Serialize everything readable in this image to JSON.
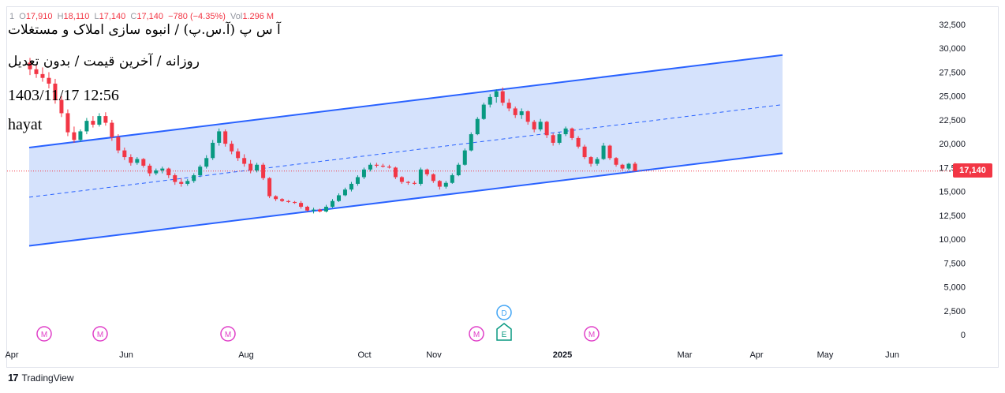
{
  "legend": {
    "interval": "1",
    "open_label": "O",
    "open": "17,910",
    "high_label": "H",
    "high": "18,110",
    "low_label": "L",
    "low": "17,140",
    "close_label": "C",
    "close": "17,140",
    "change": "−780 (−4.35%)",
    "vol_label": "Vol",
    "vol": "1.296 M"
  },
  "overlay": {
    "symbol": "آ س پ (آ.س.پ) / انبوه سازی املاک و مستغلات",
    "settings": "روزانه / آخرین قیمت / بدون تعدیل",
    "timestamp": "1403/11/17 12:56",
    "author": "hayat"
  },
  "price_badge": "17,140",
  "footer": {
    "brand": "TradingView",
    "logo": "17"
  },
  "colors": {
    "up": "#089981",
    "down": "#f23645",
    "channel_line": "#2962ff",
    "channel_fill": "#d3e0fc",
    "marker": "#e040c8",
    "dividend": "#42a5f5",
    "earnings": "#089981"
  },
  "chart_data": {
    "type": "candlestick",
    "y_ticks": [
      "32,500",
      "30,000",
      "27,500",
      "25,000",
      "22,500",
      "20,000",
      "17,500",
      "15,000",
      "12,500",
      "10,000",
      "7,500",
      "5,000",
      "2,500",
      "0"
    ],
    "x_ticks": [
      "Apr",
      "Jun",
      "Aug",
      "Oct",
      "Nov",
      "2025",
      "Mar",
      "Apr",
      "May",
      "Jun"
    ],
    "ylim": [
      0,
      32500
    ],
    "last_price": 17140,
    "channel": {
      "upper": [
        [
          0.0,
          19600
        ],
        [
          1.0,
          29300
        ]
      ],
      "mid": [
        [
          0.0,
          14400
        ],
        [
          1.0,
          24100
        ]
      ],
      "lower": [
        [
          0.0,
          9300
        ],
        [
          1.0,
          19000
        ]
      ]
    },
    "series": [
      {
        "o": 28500,
        "h": 29000,
        "l": 27200,
        "c": 27800
      },
      {
        "o": 27800,
        "h": 28300,
        "l": 26900,
        "c": 27300
      },
      {
        "o": 27300,
        "h": 28000,
        "l": 26500,
        "c": 26900
      },
      {
        "o": 26900,
        "h": 27500,
        "l": 25800,
        "c": 26300
      },
      {
        "o": 26300,
        "h": 26800,
        "l": 24200,
        "c": 24600
      },
      {
        "o": 24600,
        "h": 25000,
        "l": 22800,
        "c": 23200
      },
      {
        "o": 23200,
        "h": 23600,
        "l": 20800,
        "c": 21200
      },
      {
        "o": 21200,
        "h": 21800,
        "l": 20100,
        "c": 20400
      },
      {
        "o": 20400,
        "h": 21500,
        "l": 20200,
        "c": 21300
      },
      {
        "o": 21300,
        "h": 22700,
        "l": 21000,
        "c": 22400
      },
      {
        "o": 22400,
        "h": 22900,
        "l": 21700,
        "c": 22000
      },
      {
        "o": 22000,
        "h": 23200,
        "l": 21800,
        "c": 22900
      },
      {
        "o": 22900,
        "h": 23300,
        "l": 21900,
        "c": 22200
      },
      {
        "o": 22200,
        "h": 22500,
        "l": 20300,
        "c": 20700
      },
      {
        "o": 20700,
        "h": 21000,
        "l": 19000,
        "c": 19300
      },
      {
        "o": 19300,
        "h": 19600,
        "l": 18300,
        "c": 18600
      },
      {
        "o": 18600,
        "h": 18900,
        "l": 17700,
        "c": 18000
      },
      {
        "o": 18000,
        "h": 18600,
        "l": 17800,
        "c": 18400
      },
      {
        "o": 18400,
        "h": 18500,
        "l": 17500,
        "c": 17700
      },
      {
        "o": 17700,
        "h": 17900,
        "l": 16600,
        "c": 16900
      },
      {
        "o": 16900,
        "h": 17400,
        "l": 16700,
        "c": 17200
      },
      {
        "o": 17200,
        "h": 17600,
        "l": 16900,
        "c": 17400
      },
      {
        "o": 17400,
        "h": 17500,
        "l": 16400,
        "c": 16700
      },
      {
        "o": 16700,
        "h": 16900,
        "l": 15700,
        "c": 16000
      },
      {
        "o": 16000,
        "h": 16400,
        "l": 15500,
        "c": 15800
      },
      {
        "o": 15800,
        "h": 16300,
        "l": 15600,
        "c": 16100
      },
      {
        "o": 16100,
        "h": 16900,
        "l": 15900,
        "c": 16700
      },
      {
        "o": 16700,
        "h": 17800,
        "l": 16500,
        "c": 17600
      },
      {
        "o": 17600,
        "h": 18800,
        "l": 17400,
        "c": 18500
      },
      {
        "o": 18500,
        "h": 20400,
        "l": 18300,
        "c": 20100
      },
      {
        "o": 20100,
        "h": 21600,
        "l": 19800,
        "c": 21300
      },
      {
        "o": 21300,
        "h": 21500,
        "l": 19700,
        "c": 20000
      },
      {
        "o": 20000,
        "h": 20300,
        "l": 18900,
        "c": 19200
      },
      {
        "o": 19200,
        "h": 19500,
        "l": 18200,
        "c": 18500
      },
      {
        "o": 18500,
        "h": 18900,
        "l": 17600,
        "c": 17900
      },
      {
        "o": 17900,
        "h": 18300,
        "l": 16900,
        "c": 17200
      },
      {
        "o": 17200,
        "h": 18000,
        "l": 17000,
        "c": 17800
      },
      {
        "o": 17800,
        "h": 18000,
        "l": 16200,
        "c": 16400
      },
      {
        "o": 16400,
        "h": 16500,
        "l": 14300,
        "c": 14500
      },
      {
        "o": 14500,
        "h": 14600,
        "l": 14000,
        "c": 14200
      },
      {
        "o": 14200,
        "h": 14300,
        "l": 13900,
        "c": 14000
      },
      {
        "o": 14000,
        "h": 14100,
        "l": 13800,
        "c": 13900
      },
      {
        "o": 13900,
        "h": 14000,
        "l": 13700,
        "c": 13800
      },
      {
        "o": 13800,
        "h": 14000,
        "l": 13200,
        "c": 13400
      },
      {
        "o": 13400,
        "h": 13500,
        "l": 12900,
        "c": 13000
      },
      {
        "o": 13000,
        "h": 13300,
        "l": 12700,
        "c": 13100
      },
      {
        "o": 13100,
        "h": 13200,
        "l": 12800,
        "c": 12900
      },
      {
        "o": 12900,
        "h": 13600,
        "l": 12800,
        "c": 13400
      },
      {
        "o": 13400,
        "h": 14200,
        "l": 13300,
        "c": 14000
      },
      {
        "o": 14000,
        "h": 14800,
        "l": 13900,
        "c": 14600
      },
      {
        "o": 14600,
        "h": 15400,
        "l": 14500,
        "c": 15200
      },
      {
        "o": 15200,
        "h": 16000,
        "l": 15000,
        "c": 15800
      },
      {
        "o": 15800,
        "h": 16700,
        "l": 15600,
        "c": 16500
      },
      {
        "o": 16500,
        "h": 17500,
        "l": 16300,
        "c": 17300
      },
      {
        "o": 17300,
        "h": 18000,
        "l": 17100,
        "c": 17800
      },
      {
        "o": 17800,
        "h": 18000,
        "l": 17500,
        "c": 17700
      },
      {
        "o": 17700,
        "h": 17900,
        "l": 17500,
        "c": 17600
      },
      {
        "o": 17600,
        "h": 17800,
        "l": 17400,
        "c": 17500
      },
      {
        "o": 17500,
        "h": 17600,
        "l": 16300,
        "c": 16500
      },
      {
        "o": 16500,
        "h": 16600,
        "l": 15800,
        "c": 16000
      },
      {
        "o": 16000,
        "h": 16100,
        "l": 15700,
        "c": 15900
      },
      {
        "o": 15900,
        "h": 16100,
        "l": 15700,
        "c": 15800
      },
      {
        "o": 15800,
        "h": 17500,
        "l": 15600,
        "c": 17300
      },
      {
        "o": 17300,
        "h": 17400,
        "l": 16600,
        "c": 16800
      },
      {
        "o": 16800,
        "h": 16900,
        "l": 15900,
        "c": 16100
      },
      {
        "o": 16100,
        "h": 16200,
        "l": 15200,
        "c": 15500
      },
      {
        "o": 15500,
        "h": 16100,
        "l": 15300,
        "c": 15900
      },
      {
        "o": 15900,
        "h": 16900,
        "l": 15800,
        "c": 16700
      },
      {
        "o": 16700,
        "h": 18000,
        "l": 16600,
        "c": 17800
      },
      {
        "o": 17800,
        "h": 19500,
        "l": 17700,
        "c": 19300
      },
      {
        "o": 19300,
        "h": 21200,
        "l": 19200,
        "c": 21000
      },
      {
        "o": 21000,
        "h": 22800,
        "l": 20900,
        "c": 22600
      },
      {
        "o": 22600,
        "h": 24300,
        "l": 22500,
        "c": 24100
      },
      {
        "o": 24100,
        "h": 25200,
        "l": 23800,
        "c": 24900
      },
      {
        "o": 24900,
        "h": 25700,
        "l": 24300,
        "c": 25500
      },
      {
        "o": 25500,
        "h": 25900,
        "l": 24000,
        "c": 24300
      },
      {
        "o": 24300,
        "h": 24700,
        "l": 23400,
        "c": 23700
      },
      {
        "o": 23700,
        "h": 23900,
        "l": 22700,
        "c": 23000
      },
      {
        "o": 23000,
        "h": 23700,
        "l": 22600,
        "c": 23400
      },
      {
        "o": 23400,
        "h": 23500,
        "l": 22000,
        "c": 22300
      },
      {
        "o": 22300,
        "h": 22500,
        "l": 21200,
        "c": 21500
      },
      {
        "o": 21500,
        "h": 22600,
        "l": 21300,
        "c": 22300
      },
      {
        "o": 22300,
        "h": 22400,
        "l": 20600,
        "c": 20900
      },
      {
        "o": 20900,
        "h": 21100,
        "l": 19800,
        "c": 20100
      },
      {
        "o": 20100,
        "h": 21200,
        "l": 19900,
        "c": 21000
      },
      {
        "o": 21000,
        "h": 21800,
        "l": 20800,
        "c": 21600
      },
      {
        "o": 21600,
        "h": 21700,
        "l": 20400,
        "c": 20600
      },
      {
        "o": 20600,
        "h": 20800,
        "l": 19500,
        "c": 19700
      },
      {
        "o": 19700,
        "h": 19900,
        "l": 18400,
        "c": 18600
      },
      {
        "o": 18600,
        "h": 18700,
        "l": 17600,
        "c": 17900
      },
      {
        "o": 17900,
        "h": 18600,
        "l": 17700,
        "c": 18400
      },
      {
        "o": 18400,
        "h": 20100,
        "l": 18300,
        "c": 19800
      },
      {
        "o": 19800,
        "h": 19900,
        "l": 18300,
        "c": 18500
      },
      {
        "o": 18500,
        "h": 18600,
        "l": 17600,
        "c": 17800
      },
      {
        "o": 17800,
        "h": 17900,
        "l": 17200,
        "c": 17400
      },
      {
        "o": 17400,
        "h": 18000,
        "l": 17200,
        "c": 17900
      },
      {
        "o": 17910,
        "h": 18110,
        "l": 17140,
        "c": 17140
      }
    ],
    "event_markers": [
      {
        "kind": "M",
        "row": "bottom",
        "month_pos": 0.05
      },
      {
        "kind": "M",
        "row": "bottom",
        "month_pos": 0.13
      },
      {
        "kind": "M",
        "row": "bottom",
        "month_pos": 0.27
      },
      {
        "kind": "M",
        "row": "bottom",
        "month_pos": 0.56
      },
      {
        "kind": "D",
        "row": "top",
        "month_pos": 0.6
      },
      {
        "kind": "E",
        "row": "bottom",
        "month_pos": 0.6
      },
      {
        "kind": "M",
        "row": "bottom",
        "month_pos": 0.69
      }
    ]
  }
}
